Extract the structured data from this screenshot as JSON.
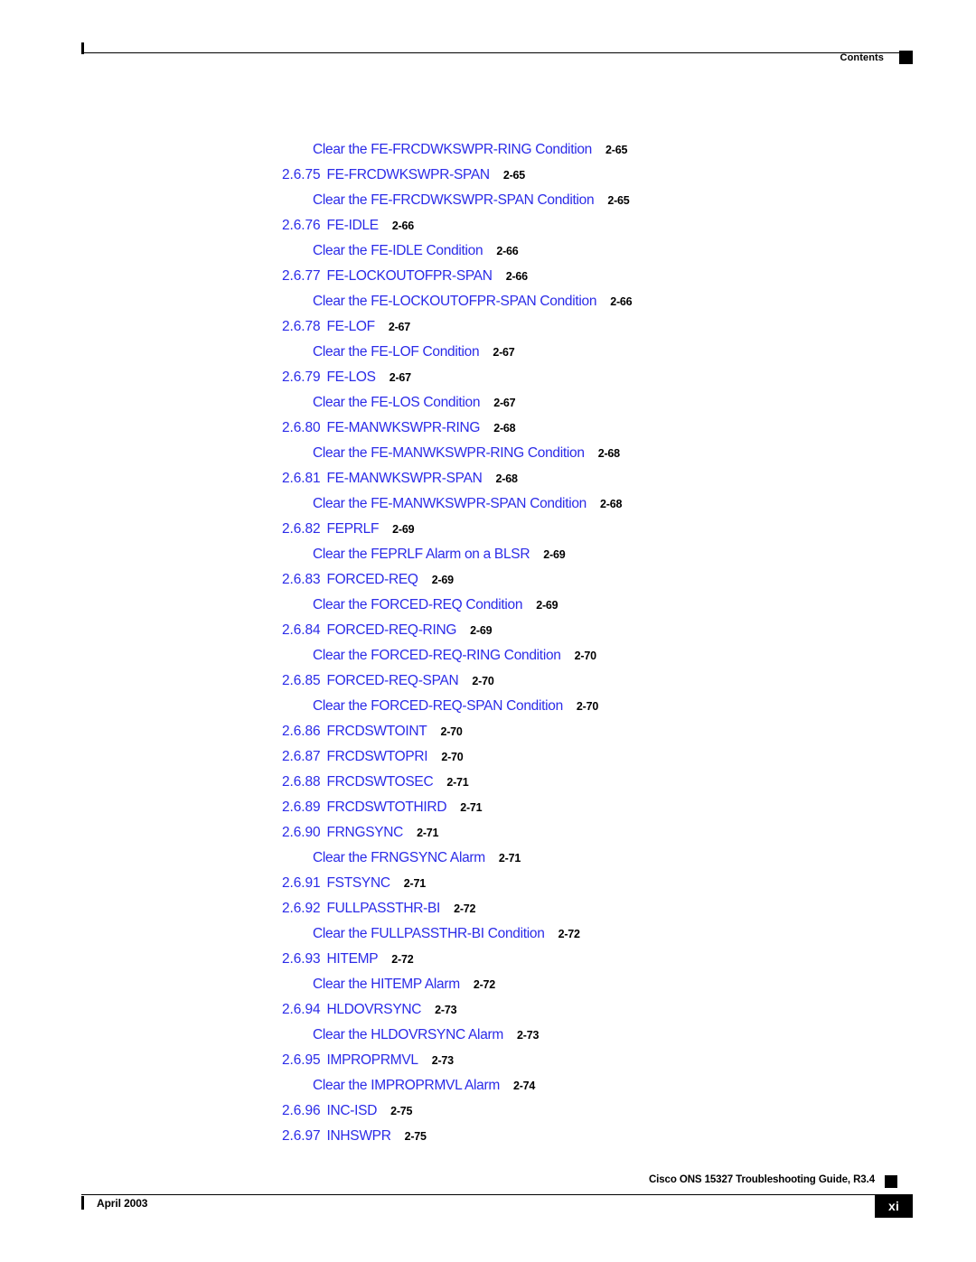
{
  "header": {
    "label": "Contents"
  },
  "footer": {
    "guide_title": "Cisco ONS 15327 Troubleshooting Guide, R3.4",
    "date": "April 2003",
    "page_number": "xi"
  },
  "colors": {
    "link_blue": "#2B2BE8",
    "text_black": "#000000",
    "page_background": "#FFFFFF"
  },
  "toc": {
    "entries": [
      {
        "level": 2,
        "number": "",
        "title": "Clear the FE-FRCDWKSWPR-RING Condition",
        "page": "2-65"
      },
      {
        "level": 1,
        "number": "2.6.75",
        "title": "FE-FRCDWKSWPR-SPAN",
        "page": "2-65"
      },
      {
        "level": 2,
        "number": "",
        "title": "Clear the FE-FRCDWKSWPR-SPAN Condition",
        "page": "2-65"
      },
      {
        "level": 1,
        "number": "2.6.76",
        "title": "FE-IDLE",
        "page": "2-66"
      },
      {
        "level": 2,
        "number": "",
        "title": "Clear the FE-IDLE Condition",
        "page": "2-66"
      },
      {
        "level": 1,
        "number": "2.6.77",
        "title": "FE-LOCKOUTOFPR-SPAN",
        "page": "2-66"
      },
      {
        "level": 2,
        "number": "",
        "title": "Clear the FE-LOCKOUTOFPR-SPAN Condition",
        "page": "2-66"
      },
      {
        "level": 1,
        "number": "2.6.78",
        "title": "FE-LOF",
        "page": "2-67"
      },
      {
        "level": 2,
        "number": "",
        "title": "Clear the FE-LOF Condition",
        "page": "2-67"
      },
      {
        "level": 1,
        "number": "2.6.79",
        "title": "FE-LOS",
        "page": "2-67"
      },
      {
        "level": 2,
        "number": "",
        "title": "Clear the FE-LOS Condition",
        "page": "2-67"
      },
      {
        "level": 1,
        "number": "2.6.80",
        "title": "FE-MANWKSWPR-RING",
        "page": "2-68"
      },
      {
        "level": 2,
        "number": "",
        "title": "Clear the FE-MANWKSWPR-RING Condition",
        "page": "2-68"
      },
      {
        "level": 1,
        "number": "2.6.81",
        "title": "FE-MANWKSWPR-SPAN",
        "page": "2-68"
      },
      {
        "level": 2,
        "number": "",
        "title": "Clear the FE-MANWKSWPR-SPAN Condition",
        "page": "2-68"
      },
      {
        "level": 1,
        "number": "2.6.82",
        "title": "FEPRLF",
        "page": "2-69"
      },
      {
        "level": 2,
        "number": "",
        "title": "Clear the FEPRLF Alarm on a BLSR",
        "page": "2-69"
      },
      {
        "level": 1,
        "number": "2.6.83",
        "title": "FORCED-REQ",
        "page": "2-69"
      },
      {
        "level": 2,
        "number": "",
        "title": "Clear the FORCED-REQ Condition",
        "page": "2-69"
      },
      {
        "level": 1,
        "number": "2.6.84",
        "title": "FORCED-REQ-RING",
        "page": "2-69"
      },
      {
        "level": 2,
        "number": "",
        "title": "Clear the FORCED-REQ-RING Condition",
        "page": "2-70"
      },
      {
        "level": 1,
        "number": "2.6.85",
        "title": "FORCED-REQ-SPAN",
        "page": "2-70"
      },
      {
        "level": 2,
        "number": "",
        "title": "Clear the FORCED-REQ-SPAN Condition",
        "page": "2-70"
      },
      {
        "level": 1,
        "number": "2.6.86",
        "title": "FRCDSWTOINT",
        "page": "2-70"
      },
      {
        "level": 1,
        "number": "2.6.87",
        "title": "FRCDSWTOPRI",
        "page": "2-70"
      },
      {
        "level": 1,
        "number": "2.6.88",
        "title": "FRCDSWTOSEC",
        "page": "2-71"
      },
      {
        "level": 1,
        "number": "2.6.89",
        "title": "FRCDSWTOTHIRD",
        "page": "2-71"
      },
      {
        "level": 1,
        "number": "2.6.90",
        "title": "FRNGSYNC",
        "page": "2-71"
      },
      {
        "level": 2,
        "number": "",
        "title": "Clear the FRNGSYNC Alarm",
        "page": "2-71"
      },
      {
        "level": 1,
        "number": "2.6.91",
        "title": "FSTSYNC",
        "page": "2-71"
      },
      {
        "level": 1,
        "number": "2.6.92",
        "title": "FULLPASSTHR-BI",
        "page": "2-72"
      },
      {
        "level": 2,
        "number": "",
        "title": "Clear the FULLPASSTHR-BI Condition",
        "page": "2-72"
      },
      {
        "level": 1,
        "number": "2.6.93",
        "title": "HITEMP",
        "page": "2-72"
      },
      {
        "level": 2,
        "number": "",
        "title": "Clear the HITEMP Alarm",
        "page": "2-72"
      },
      {
        "level": 1,
        "number": "2.6.94",
        "title": "HLDOVRSYNC",
        "page": "2-73"
      },
      {
        "level": 2,
        "number": "",
        "title": "Clear the HLDOVRSYNC Alarm",
        "page": "2-73"
      },
      {
        "level": 1,
        "number": "2.6.95",
        "title": "IMPROPRMVL",
        "page": "2-73"
      },
      {
        "level": 2,
        "number": "",
        "title": "Clear the IMPROPRMVL Alarm",
        "page": "2-74"
      },
      {
        "level": 1,
        "number": "2.6.96",
        "title": "INC-ISD",
        "page": "2-75"
      },
      {
        "level": 1,
        "number": "2.6.97",
        "title": "INHSWPR",
        "page": "2-75"
      }
    ]
  }
}
